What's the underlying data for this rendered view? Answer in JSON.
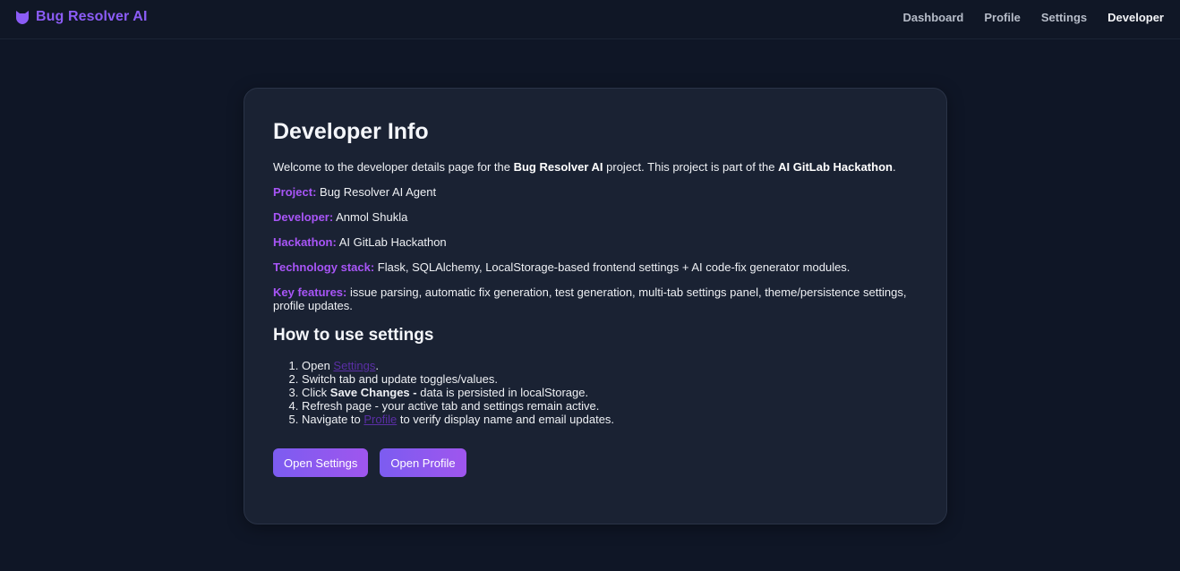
{
  "nav": {
    "brand": "Bug Resolver AI",
    "brand_icon": "cat-shield-icon",
    "brand_color": "#8b5cf6",
    "links": [
      "Dashboard",
      "Profile",
      "Settings",
      "Developer"
    ],
    "active": "Developer"
  },
  "card": {
    "title": "Developer Info",
    "intro": {
      "t1": "Welcome to the developer details page for the ",
      "b1": "Bug Resolver AI",
      "t2": " project. This project is part of the ",
      "b2": "AI GitLab Hackathon",
      "t3": "."
    },
    "fields": [
      {
        "label": "Project:",
        "value": " Bug Resolver AI Agent"
      },
      {
        "label": "Developer:",
        "value": " Anmol Shukla"
      },
      {
        "label": "Hackathon:",
        "value": " AI GitLab Hackathon"
      },
      {
        "label": "Technology stack:",
        "value": " Flask, SQLAlchemy, LocalStorage-based frontend settings + AI code-fix generator modules."
      },
      {
        "label": "Key features:",
        "value": " issue parsing, automatic fix generation, test generation, multi-tab settings panel, theme/persistence settings, profile updates."
      }
    ],
    "label_color": "#a855f7",
    "howto_title": "How to use settings",
    "steps": {
      "s1": {
        "pre": "Open ",
        "link": "Settings",
        "post": "."
      },
      "s2": "Switch tab and update toggles/values.",
      "s3": {
        "pre": "Click ",
        "bold": "Save Changes -",
        "post": " data is persisted in localStorage."
      },
      "s4": "Refresh page - your active tab and settings remain active.",
      "s5": {
        "pre": "Navigate to ",
        "link": "Profile",
        "post": " to verify display name and email updates."
      }
    },
    "buttons": {
      "open_settings": "Open Settings",
      "open_profile": "Open Profile"
    }
  }
}
